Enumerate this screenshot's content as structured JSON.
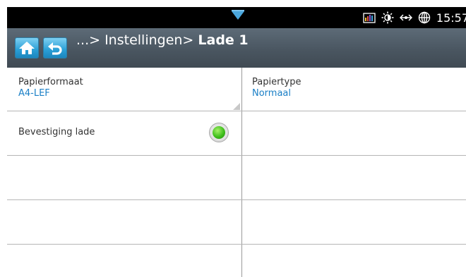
{
  "status_bar": {
    "time": "15:57",
    "icons": [
      "notification-arrow-icon",
      "signal-bars-icon",
      "brightness-icon",
      "network-icon",
      "globe-icon"
    ],
    "colors": {
      "background": "#000000",
      "arrow": "#4aa6dd"
    }
  },
  "nav": {
    "home_icon": "home-icon",
    "back_icon": "back-icon",
    "breadcrumb_prefix": "...> Instellingen> ",
    "breadcrumb_current": "Lade 1",
    "colors": {
      "bar": "#4a5661",
      "button": "#2a9fd6"
    }
  },
  "settings": {
    "paper_size": {
      "label": "Papierformaat",
      "value": "A4-LEF"
    },
    "paper_type": {
      "label": "Papiertype",
      "value": "Normaal"
    },
    "tray_confirm": {
      "label": "Bevestiging lade",
      "state": "on"
    },
    "colors": {
      "value": "#1a7fc6",
      "indicator_on": "#3fbf1c"
    }
  }
}
